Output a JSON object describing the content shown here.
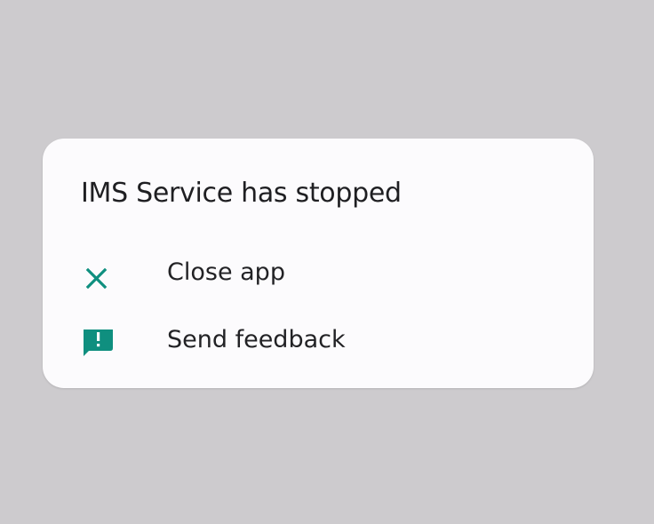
{
  "dialog": {
    "title": "IMS Service has stopped",
    "options": [
      {
        "label": "Close app",
        "icon": "close-icon"
      },
      {
        "label": "Send feedback",
        "icon": "feedback-icon"
      }
    ]
  },
  "colors": {
    "background": "#cdcbce",
    "dialog": "#fcfbfd",
    "accent": "#0f8f7f",
    "text": "#222225"
  }
}
